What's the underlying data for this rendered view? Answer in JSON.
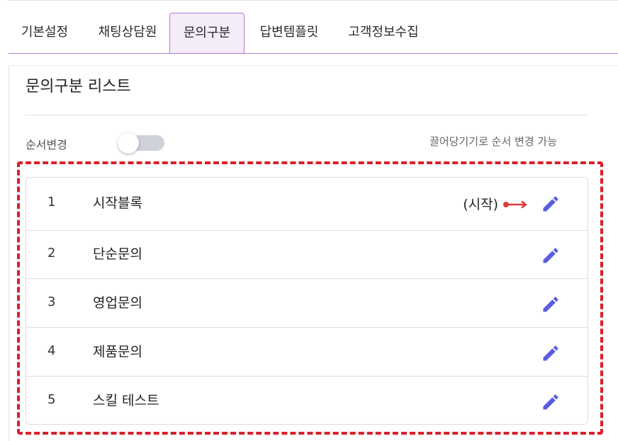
{
  "tabs": [
    {
      "label": "기본설정",
      "active": false
    },
    {
      "label": "채팅상담원",
      "active": false
    },
    {
      "label": "문의구분",
      "active": true
    },
    {
      "label": "답변템플릿",
      "active": false
    },
    {
      "label": "고객정보수집",
      "active": false
    }
  ],
  "panel": {
    "title": "문의구분 리스트",
    "order_label": "순서변경",
    "toggle_on": false,
    "drag_hint": "끌어당기기로 순서 변경 가능"
  },
  "list": [
    {
      "number": "1",
      "name": "시작블록",
      "start_label": "(시작)"
    },
    {
      "number": "2",
      "name": "단순문의"
    },
    {
      "number": "3",
      "name": "영업문의"
    },
    {
      "number": "4",
      "name": "제품문의"
    },
    {
      "number": "5",
      "name": "스킬 테스트"
    }
  ],
  "colors": {
    "accent": "#b57ad0",
    "edit_icon": "#5b5ce0",
    "highlight_dash": "#d8202a",
    "arrow": "#e03a3a"
  },
  "icons": {
    "edit": "pencil-icon",
    "arrow": "arrow-right-icon"
  }
}
